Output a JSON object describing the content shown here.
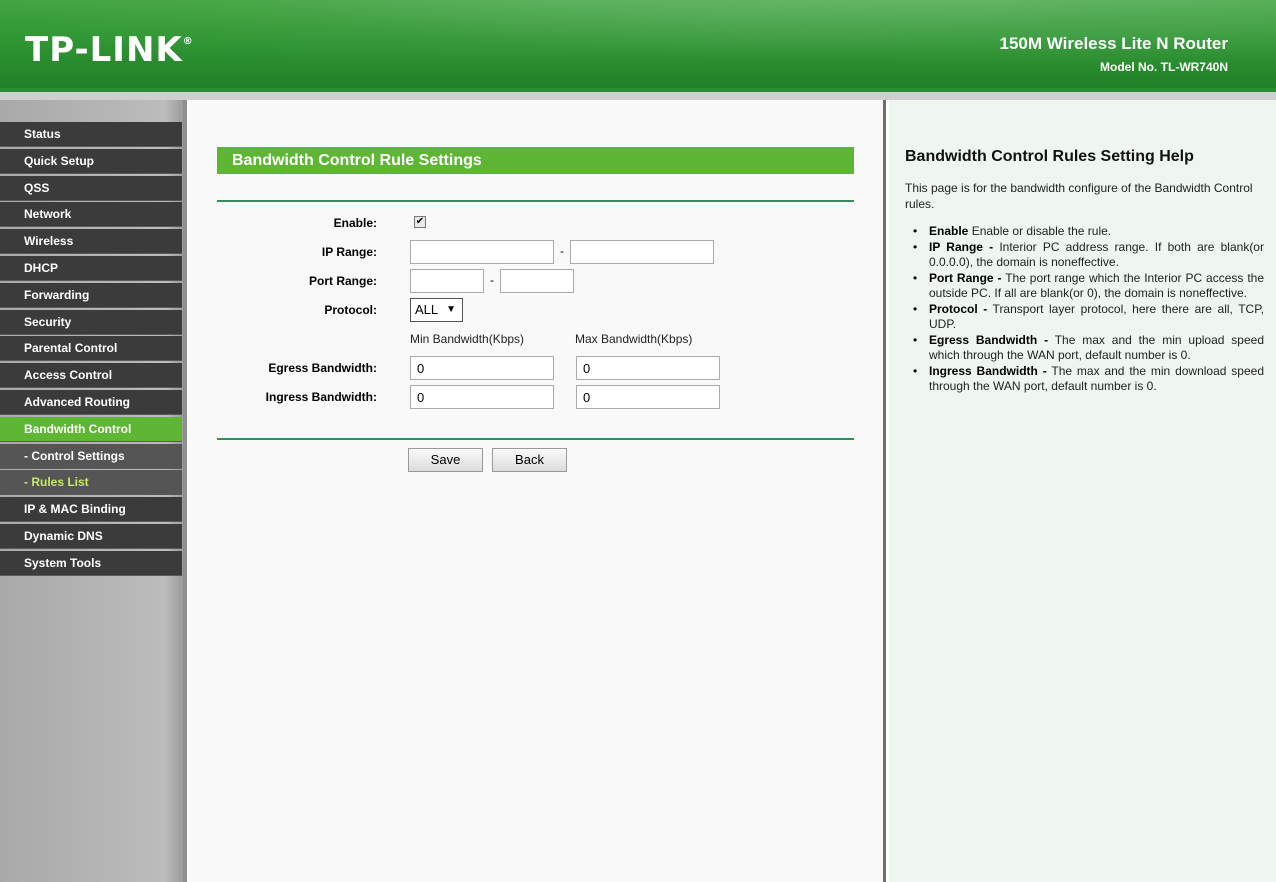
{
  "header": {
    "logo_text": "TP-LINK",
    "logo_mark": "®",
    "product_name": "150M Wireless Lite N Router",
    "model": "Model No. TL-WR740N"
  },
  "sidebar": {
    "items": [
      {
        "label": "Status",
        "state": "normal"
      },
      {
        "label": "Quick Setup",
        "state": "normal"
      },
      {
        "label": "QSS",
        "state": "normal"
      },
      {
        "label": "Network",
        "state": "normal"
      },
      {
        "label": "Wireless",
        "state": "normal"
      },
      {
        "label": "DHCP",
        "state": "normal"
      },
      {
        "label": "Forwarding",
        "state": "normal"
      },
      {
        "label": "Security",
        "state": "normal"
      },
      {
        "label": "Parental Control",
        "state": "normal"
      },
      {
        "label": "Access Control",
        "state": "normal"
      },
      {
        "label": "Advanced Routing",
        "state": "normal"
      },
      {
        "label": "Bandwidth Control",
        "state": "active"
      },
      {
        "label": "- Control Settings",
        "state": "sub"
      },
      {
        "label": "- Rules List",
        "state": "sub-active"
      },
      {
        "label": "IP & MAC Binding",
        "state": "normal"
      },
      {
        "label": "Dynamic DNS",
        "state": "normal"
      },
      {
        "label": "System Tools",
        "state": "normal"
      }
    ]
  },
  "main": {
    "title": "Bandwidth Control Rule Settings",
    "enable_label": "Enable:",
    "enable_checked": true,
    "check_glyph": "✔",
    "ip_range_label": "IP Range:",
    "ip_start": "",
    "ip_end": "",
    "port_range_label": "Port Range:",
    "port_start": "",
    "port_end": "",
    "dash": "-",
    "protocol_label": "Protocol:",
    "protocol_value": "ALL",
    "select_arrow": "▼",
    "min_header": "Min Bandwidth(Kbps)",
    "max_header": "Max Bandwidth(Kbps)",
    "egress_label": "Egress Bandwidth:",
    "egress_min": "0",
    "egress_max": "0",
    "ingress_label": "Ingress Bandwidth:",
    "ingress_min": "0",
    "ingress_max": "0",
    "save_label": "Save",
    "back_label": "Back"
  },
  "help": {
    "title": "Bandwidth Control Rules Setting Help",
    "intro": "This page is for the bandwidth configure of the Bandwidth Control rules.",
    "items": [
      {
        "term": "Enable",
        "text": " Enable or disable the rule."
      },
      {
        "term": "IP Range -",
        "text": " Interior PC address range. If both are blank(or 0.0.0.0), the domain is noneffective."
      },
      {
        "term": "Port Range -",
        "text": " The port range which the Interior PC access the outside PC. If all are blank(or 0), the domain is noneffective."
      },
      {
        "term": "Protocol -",
        "text": " Transport layer protocol, here there are all, TCP, UDP."
      },
      {
        "term": "Egress Bandwidth -",
        "text": " The max and the min upload speed which through the WAN port, default number is 0."
      },
      {
        "term": "Ingress Bandwidth -",
        "text": " The max and the min download speed through the WAN port, default number is 0."
      }
    ]
  },
  "colors": {
    "brand_green": "#5fb635",
    "menu_dark": "#3b3b3b",
    "active_sub_text": "#c7e86a",
    "help_bg": "#eef6ef"
  }
}
